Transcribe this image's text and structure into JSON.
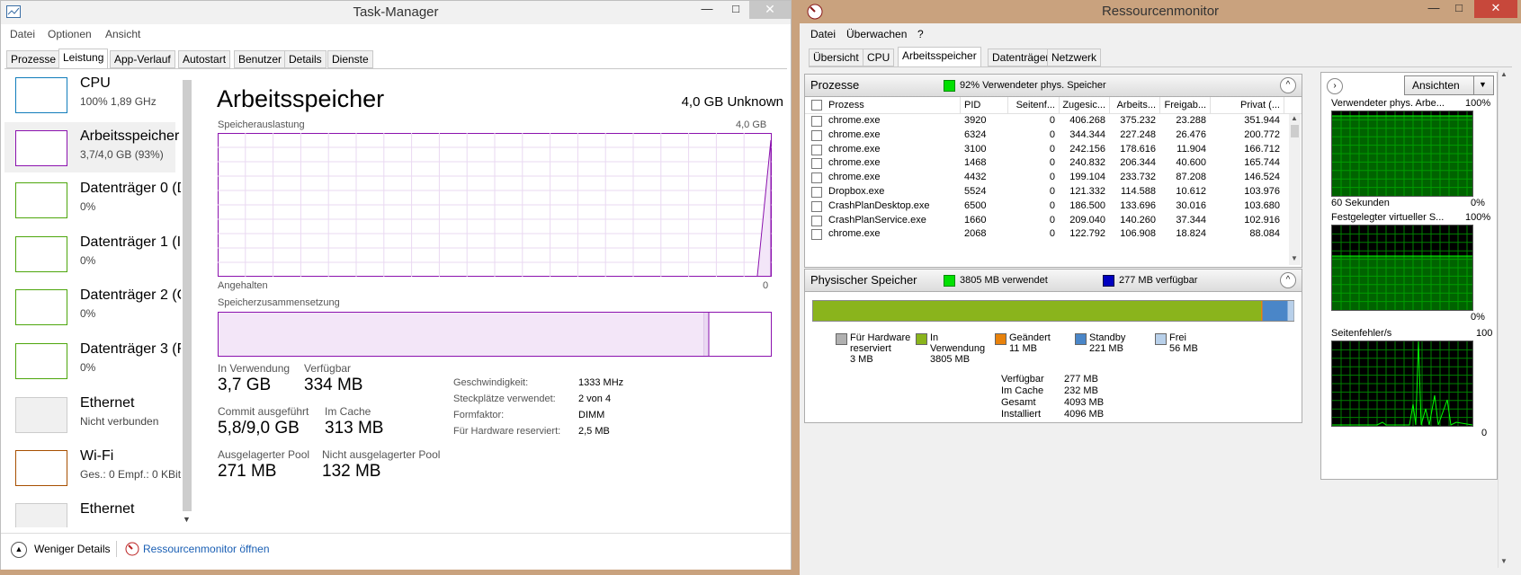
{
  "taskmgr": {
    "title": "Task-Manager",
    "menu": [
      "Datei",
      "Optionen",
      "Ansicht"
    ],
    "tabs": [
      "Prozesse",
      "Leistung",
      "App-Verlauf",
      "Autostart",
      "Benutzer",
      "Details",
      "Dienste"
    ],
    "active_tab": "Leistung",
    "items": [
      {
        "name": "CPU",
        "sub": "100% 1,89 GHz",
        "color": "#117dbb"
      },
      {
        "name": "Arbeitsspeicher",
        "sub": "3,7/4,0 GB (93%)",
        "color": "#8b12ae"
      },
      {
        "name": "Datenträger 0 (D",
        "sub": "0%",
        "color": "#4da60c"
      },
      {
        "name": "Datenträger 1 (I",
        "sub": "0%",
        "color": "#4da60c"
      },
      {
        "name": "Datenträger 2 (C",
        "sub": "0%",
        "color": "#4da60c"
      },
      {
        "name": "Datenträger 3 (F",
        "sub": "0%",
        "color": "#4da60c"
      },
      {
        "name": "Ethernet",
        "sub": "Nicht verbunden",
        "color": "#cccccc"
      },
      {
        "name": "Wi-Fi",
        "sub": "Ges.: 0 Empf.: 0 KBit/",
        "color": "#a74f01"
      },
      {
        "name": "Ethernet",
        "sub": "",
        "color": "#cccccc"
      }
    ],
    "main": {
      "title": "Arbeitsspeicher",
      "capacity": "4,0 GB Unknown",
      "usage_label": "Speicherauslastung",
      "usage_max": "4,0 GB",
      "paused_label": "Angehalten",
      "paused_value": "0",
      "composition_label": "Speicherzusammensetzung",
      "stats": {
        "in_use_label": "In Verwendung",
        "in_use": "3,7 GB",
        "available_label": "Verfügbar",
        "available": "334 MB",
        "commit_label": "Commit ausgeführt",
        "commit": "5,8/9,0 GB",
        "cached_label": "Im Cache",
        "cached": "313 MB",
        "paged_label": "Ausgelagerter Pool",
        "paged": "271 MB",
        "nonpaged_label": "Nicht ausgelagerter Pool",
        "nonpaged": "132 MB"
      },
      "details": [
        {
          "k": "Geschwindigkeit:",
          "v": "1333 MHz"
        },
        {
          "k": "Steckplätze verwendet:",
          "v": "2 von 4"
        },
        {
          "k": "Formfaktor:",
          "v": "DIMM"
        },
        {
          "k": "Für Hardware reserviert:",
          "v": "2,5 MB"
        }
      ]
    },
    "footer": {
      "fewer": "Weniger Details",
      "resmon": "Ressourcenmonitor öffnen"
    }
  },
  "resmon": {
    "title": "Ressourcenmonitor",
    "menu": [
      "Datei",
      "Überwachen",
      "?"
    ],
    "tabs": [
      "Übersicht",
      "CPU",
      "Arbeitsspeicher",
      "Datenträger",
      "Netzwerk"
    ],
    "active_tab": "Arbeitsspeicher",
    "processes": {
      "title": "Prozesse",
      "indicator": "92% Verwendeter phys. Speicher",
      "columns": [
        "Prozess",
        "PID",
        "Seitenf...",
        "Zugesic...",
        "Arbeits...",
        "Freigab...",
        "Privat (..."
      ],
      "rows": [
        [
          "chrome.exe",
          "3920",
          "0",
          "406.268",
          "375.232",
          "23.288",
          "351.944"
        ],
        [
          "chrome.exe",
          "6324",
          "0",
          "344.344",
          "227.248",
          "26.476",
          "200.772"
        ],
        [
          "chrome.exe",
          "3100",
          "0",
          "242.156",
          "178.616",
          "11.904",
          "166.712"
        ],
        [
          "chrome.exe",
          "1468",
          "0",
          "240.832",
          "206.344",
          "40.600",
          "165.744"
        ],
        [
          "chrome.exe",
          "4432",
          "0",
          "199.104",
          "233.732",
          "87.208",
          "146.524"
        ],
        [
          "Dropbox.exe",
          "5524",
          "0",
          "121.332",
          "114.588",
          "10.612",
          "103.976"
        ],
        [
          "CrashPlanDesktop.exe",
          "6500",
          "0",
          "186.500",
          "133.696",
          "30.016",
          "103.680"
        ],
        [
          "CrashPlanService.exe",
          "1660",
          "0",
          "209.040",
          "140.260",
          "37.344",
          "102.916"
        ],
        [
          "chrome.exe",
          "2068",
          "0",
          "122.792",
          "106.908",
          "18.824",
          "88.084"
        ]
      ]
    },
    "physical": {
      "title": "Physischer Speicher",
      "used": "3805 MB verwendet",
      "available": "277 MB verfügbar",
      "legend": [
        {
          "l1": "Für Hardware",
          "l2": "reserviert",
          "v": "3 MB",
          "color": "#b0b0b0"
        },
        {
          "l1": "In",
          "l2": "Verwendung",
          "v": "3805 MB",
          "color": "#8ab41c"
        },
        {
          "l1": "Geändert",
          "l2": "",
          "v": "11 MB",
          "color": "#e8820c"
        },
        {
          "l1": "Standby",
          "l2": "",
          "v": "221 MB",
          "color": "#4a86c8"
        },
        {
          "l1": "Frei",
          "l2": "",
          "v": "56 MB",
          "color": "#b8d0ea"
        }
      ],
      "summary": [
        {
          "k": "Verfügbar",
          "v": "277 MB"
        },
        {
          "k": "Im Cache",
          "v": "232 MB"
        },
        {
          "k": "Gesamt",
          "v": "4093 MB"
        },
        {
          "k": "Installiert",
          "v": "4096 MB"
        }
      ]
    },
    "side": {
      "views_btn": "Ansichten",
      "graph1_title": "Verwendeter phys. Arbe...",
      "graph1_max": "100%",
      "graph1_left": "60 Sekunden",
      "graph1_min": "0%",
      "graph2_title": "Festgelegter virtueller S...",
      "graph2_max": "100%",
      "graph2_min": "0%",
      "graph3_title": "Seitenfehler/s",
      "graph3_max": "100",
      "graph3_min": "0"
    }
  },
  "colors": {
    "memory_purple": "#8b12ae",
    "graph_green": "#00c800",
    "bar_green": "#8ab41c"
  }
}
